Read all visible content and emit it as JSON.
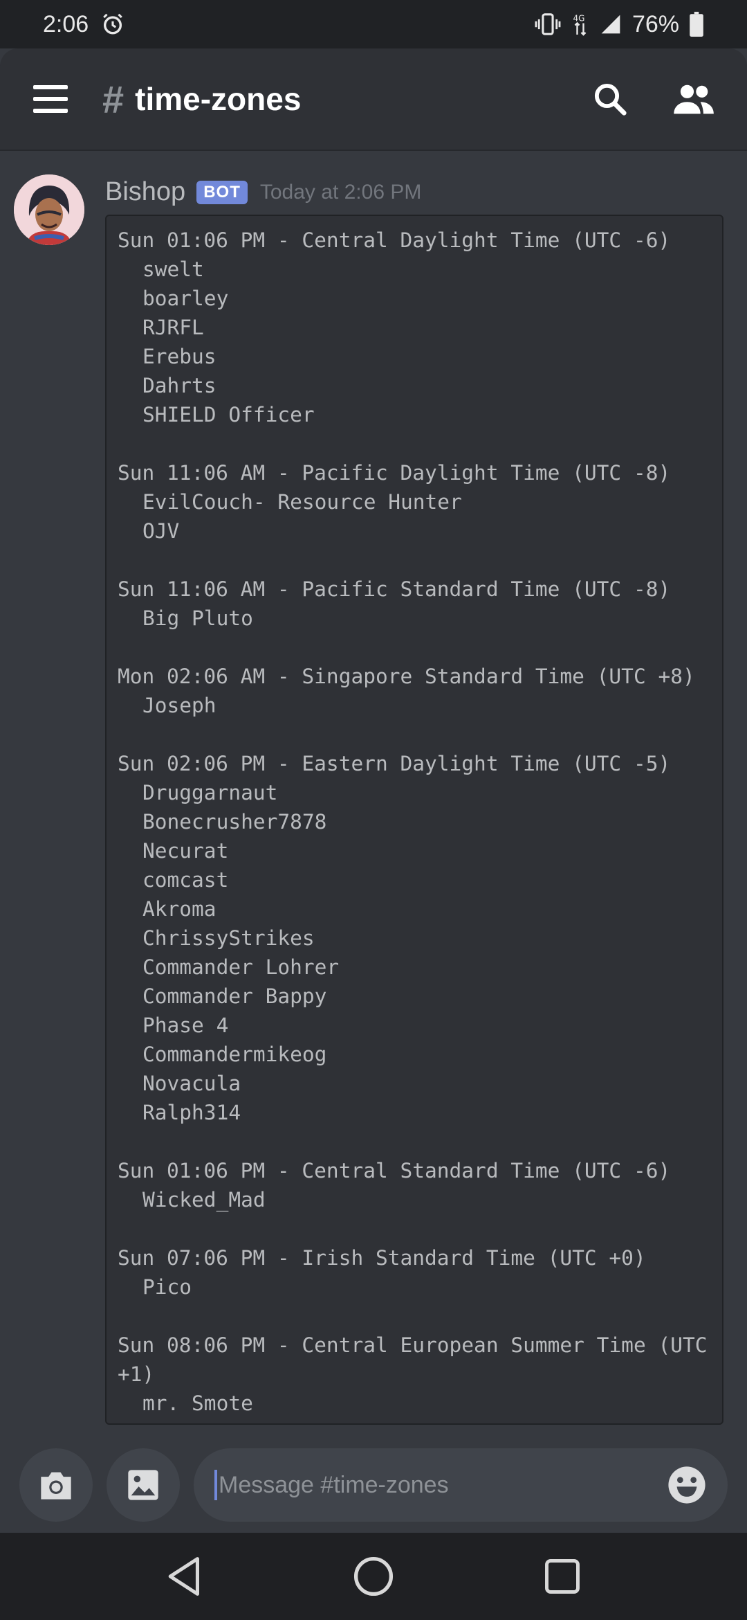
{
  "status_bar": {
    "time": "2:06",
    "battery": "76%",
    "icons": [
      "alarm-icon",
      "vibrate-icon",
      "lte-icon",
      "signal-icon",
      "battery-icon"
    ]
  },
  "header": {
    "hash": "#",
    "channel": "time-zones"
  },
  "message": {
    "author": "Bishop",
    "badge": "BOT",
    "timestamp": "Today at 2:06 PM",
    "zones": [
      {
        "title": "Sun 01:06 PM - Central Daylight Time (UTC -6)",
        "members": [
          "swelt",
          "boarley",
          "RJRFL",
          "Erebus",
          "Dahrts",
          "SHIELD Officer"
        ]
      },
      {
        "title": "Sun 11:06 AM - Pacific Daylight Time (UTC -8)",
        "members": [
          "EvilCouch- Resource Hunter",
          "OJV"
        ]
      },
      {
        "title": "Sun 11:06 AM - Pacific Standard Time (UTC -8)",
        "members": [
          "Big Pluto"
        ]
      },
      {
        "title": "Mon 02:06 AM - Singapore Standard Time (UTC +8)",
        "members": [
          "Joseph"
        ]
      },
      {
        "title": "Sun 02:06 PM - Eastern Daylight Time (UTC -5)",
        "members": [
          "Druggarnaut",
          "Bonecrusher7878",
          "Necurat",
          "comcast",
          "Akroma",
          "ChrissyStrikes",
          "Commander Lohrer",
          "Commander Bappy",
          "Phase 4",
          "Commandermikeog",
          "Novacula",
          "Ralph314"
        ]
      },
      {
        "title": "Sun 01:06 PM - Central Standard Time (UTC -6)",
        "members": [
          "Wicked_Mad"
        ]
      },
      {
        "title": "Sun 07:06 PM - Irish Standard Time (UTC +0)",
        "members": [
          "Pico"
        ]
      },
      {
        "title": "Sun 08:06 PM - Central European Summer Time (UTC +1)",
        "members": [
          "mr. Smote"
        ]
      }
    ]
  },
  "composer": {
    "placeholder": "Message #time-zones"
  },
  "colors": {
    "background": "#36393f",
    "header": "#2f3136",
    "accent": "#7289da"
  }
}
